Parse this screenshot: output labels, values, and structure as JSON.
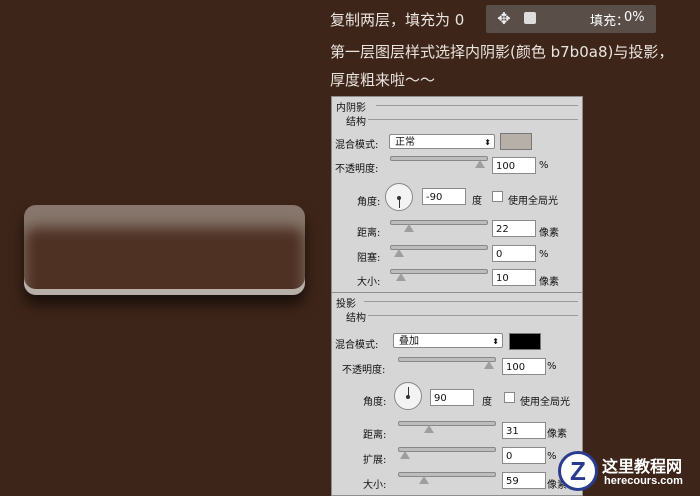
{
  "captions": {
    "line1": "复制两层，填充为 0",
    "line2": "第一层图层样式选择内阴影(颜色 b7b0a8)与投影，",
    "line3": "厚度粗来啦〜〜"
  },
  "toolstrip": {
    "fill_label": "填充：",
    "fill_value": "0%"
  },
  "inner_shadow": {
    "title": "内阴影",
    "group": "结构",
    "blend_label": "混合模式:",
    "blend_value": "正常",
    "color": "#b7b0a8",
    "opacity_label": "不透明度:",
    "opacity_value": "100",
    "opacity_unit": "%",
    "angle_label": "角度:",
    "angle_value": "-90",
    "angle_unit": "度",
    "global_light_label": "使用全局光",
    "distance_label": "距离:",
    "distance_value": "22",
    "distance_unit": "像素",
    "choke_label": "阻塞:",
    "choke_value": "0",
    "choke_unit": "%",
    "size_label": "大小:",
    "size_value": "10",
    "size_unit": "像素"
  },
  "drop_shadow": {
    "title": "投影",
    "group": "结构",
    "blend_label": "混合模式:",
    "blend_value": "叠加",
    "color": "#000000",
    "opacity_label": "不透明度:",
    "opacity_value": "100",
    "opacity_unit": "%",
    "angle_label": "角度:",
    "angle_value": "90",
    "angle_unit": "度",
    "global_light_label": "使用全局光",
    "distance_label": "距离:",
    "distance_value": "31",
    "distance_unit": "像素",
    "spread_label": "扩展:",
    "spread_value": "0",
    "spread_unit": "%",
    "size_label": "大小:",
    "size_value": "59",
    "size_unit": "像素"
  },
  "watermark": {
    "logo_letter": "Z",
    "title": "这里教程网",
    "subtitle": "herecours.com"
  }
}
